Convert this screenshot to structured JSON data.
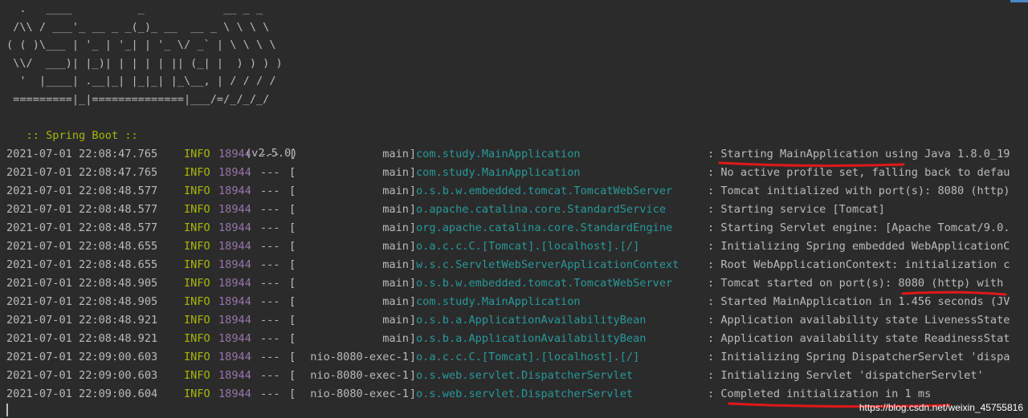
{
  "banner": {
    "ascii": "  .   ____          _            __ _ _\n /\\\\ / ___'_ __ _ _(_)_ __  __ _ \\ \\ \\ \\\n( ( )\\___ | '_ | '_| | '_ \\/ _` | \\ \\ \\ \\\n \\\\/  ___)| |_)| | | | | || (_| |  ) ) ) )\n  '  |____| .__|_| |_|_| |_\\__, | / / / /\n =========|_|==============|___/=/_/_/_/",
    "spring_label": " :: Spring Boot ::",
    "version": "(v2.5.0)"
  },
  "log": [
    {
      "ts": "2021-07-01 22:08:47.765",
      "level": "INFO",
      "pid": "18944",
      "sep": "---",
      "thread": "main",
      "logger": "com.study.MainApplication",
      "msg": ": Starting MainApplication using Java 1.8.0_19"
    },
    {
      "ts": "2021-07-01 22:08:47.765",
      "level": "INFO",
      "pid": "18944",
      "sep": "---",
      "thread": "main",
      "logger": "com.study.MainApplication",
      "msg": ": No active profile set, falling back to defau"
    },
    {
      "ts": "2021-07-01 22:08:48.577",
      "level": "INFO",
      "pid": "18944",
      "sep": "---",
      "thread": "main",
      "logger": "o.s.b.w.embedded.tomcat.TomcatWebServer",
      "msg": ": Tomcat initialized with port(s): 8080 (http)"
    },
    {
      "ts": "2021-07-01 22:08:48.577",
      "level": "INFO",
      "pid": "18944",
      "sep": "---",
      "thread": "main",
      "logger": "o.apache.catalina.core.StandardService",
      "msg": ": Starting service [Tomcat]"
    },
    {
      "ts": "2021-07-01 22:08:48.577",
      "level": "INFO",
      "pid": "18944",
      "sep": "---",
      "thread": "main",
      "logger": "org.apache.catalina.core.StandardEngine",
      "msg": ": Starting Servlet engine: [Apache Tomcat/9.0."
    },
    {
      "ts": "2021-07-01 22:08:48.655",
      "level": "INFO",
      "pid": "18944",
      "sep": "---",
      "thread": "main",
      "logger": "o.a.c.c.C.[Tomcat].[localhost].[/]",
      "msg": ": Initializing Spring embedded WebApplicationC"
    },
    {
      "ts": "2021-07-01 22:08:48.655",
      "level": "INFO",
      "pid": "18944",
      "sep": "---",
      "thread": "main",
      "logger": "w.s.c.ServletWebServerApplicationContext",
      "msg": ": Root WebApplicationContext: initialization c"
    },
    {
      "ts": "2021-07-01 22:08:48.905",
      "level": "INFO",
      "pid": "18944",
      "sep": "---",
      "thread": "main",
      "logger": "o.s.b.w.embedded.tomcat.TomcatWebServer",
      "msg": ": Tomcat started on port(s): 8080 (http) with"
    },
    {
      "ts": "2021-07-01 22:08:48.905",
      "level": "INFO",
      "pid": "18944",
      "sep": "---",
      "thread": "main",
      "logger": "com.study.MainApplication",
      "msg": ": Started MainApplication in 1.456 seconds (JV"
    },
    {
      "ts": "2021-07-01 22:08:48.921",
      "level": "INFO",
      "pid": "18944",
      "sep": "---",
      "thread": "main",
      "logger": "o.s.b.a.ApplicationAvailabilityBean",
      "msg": ": Application availability state LivenessState"
    },
    {
      "ts": "2021-07-01 22:08:48.921",
      "level": "INFO",
      "pid": "18944",
      "sep": "---",
      "thread": "main",
      "logger": "o.s.b.a.ApplicationAvailabilityBean",
      "msg": ": Application availability state ReadinessStat"
    },
    {
      "ts": "2021-07-01 22:09:00.603",
      "level": "INFO",
      "pid": "18944",
      "sep": "---",
      "thread": "nio-8080-exec-1",
      "logger": "o.a.c.c.C.[Tomcat].[localhost].[/]",
      "msg": ": Initializing Spring DispatcherServlet 'dispa"
    },
    {
      "ts": "2021-07-01 22:09:00.603",
      "level": "INFO",
      "pid": "18944",
      "sep": "---",
      "thread": "nio-8080-exec-1",
      "logger": "o.s.web.servlet.DispatcherServlet",
      "msg": ": Initializing Servlet 'dispatcherServlet'"
    },
    {
      "ts": "2021-07-01 22:09:00.604",
      "level": "INFO",
      "pid": "18944",
      "sep": "---",
      "thread": "nio-8080-exec-1",
      "logger": "o.s.web.servlet.DispatcherServlet",
      "msg": ": Completed initialization in 1 ms"
    }
  ],
  "watermark": "https://blog.csdn.net/weixin_45755816",
  "colors": {
    "background": "#2b2b2b",
    "text": "#bbbbbb",
    "info_level": "#a6b80a",
    "pid": "#9876aa",
    "logger": "#299999",
    "annotation": "#e0191b"
  }
}
